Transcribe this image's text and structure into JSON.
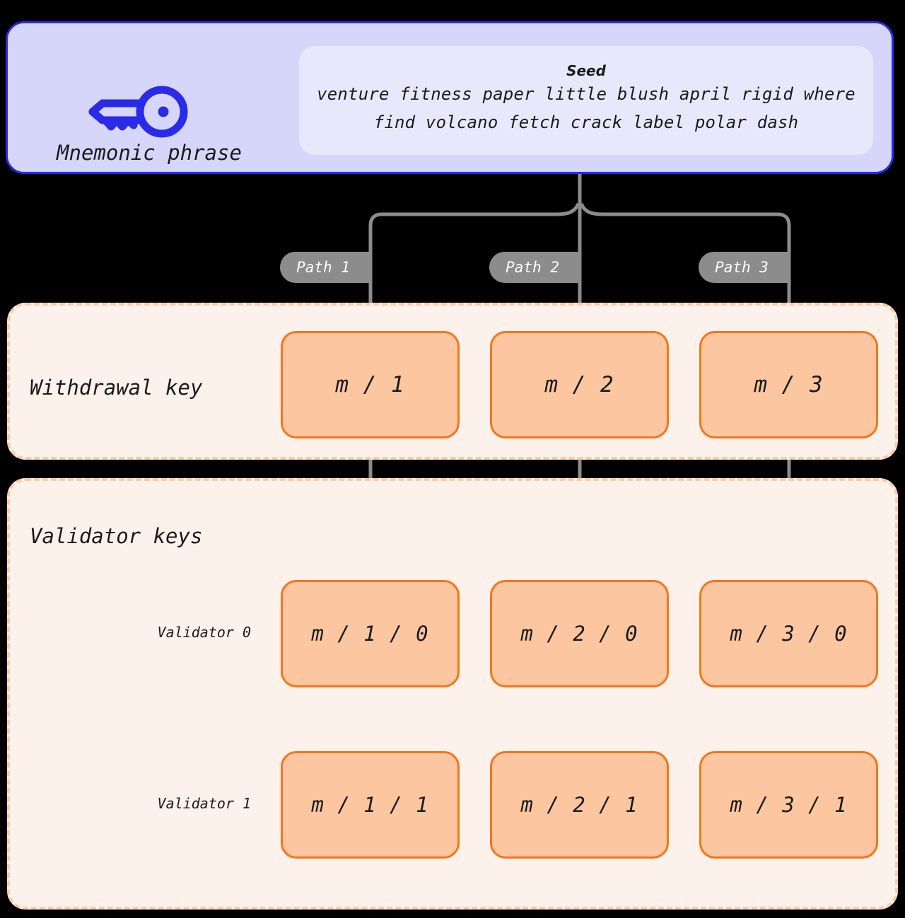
{
  "diagram": {
    "title": "Mnemonic phrase to validator key derivation",
    "colors": {
      "mnemonic_fill": "#D6D6FA",
      "mnemonic_border": "#2A2AE8",
      "seed_fill": "#E8E8FC",
      "key_icon": "#2A2AE8",
      "group_fill": "#FDF1EC",
      "group_border": "#FBCBA8",
      "key_box_fill": "#FBC6A0",
      "key_box_border": "#F4761B",
      "connector": "#8C8C8C",
      "badge_fill": "#8C8C8C",
      "badge_text": "#FFFFFF",
      "background": "#000000"
    }
  },
  "mnemonic": {
    "icon": "key-icon",
    "label": "Mnemonic phrase",
    "seed": {
      "title": "Seed",
      "line1": "venture fitness paper little blush april rigid where",
      "line2": "find volcano fetch crack label polar dash",
      "words": [
        "venture",
        "fitness",
        "paper",
        "little",
        "blush",
        "april",
        "rigid",
        "where",
        "find",
        "volcano",
        "fetch",
        "crack",
        "label",
        "polar",
        "dash"
      ]
    }
  },
  "paths": [
    {
      "label": "Path 1"
    },
    {
      "label": "Path 2"
    },
    {
      "label": "Path 3"
    }
  ],
  "withdrawal": {
    "title": "Withdrawal key",
    "keys": [
      {
        "label": "m / 1"
      },
      {
        "label": "m / 2"
      },
      {
        "label": "m / 3"
      }
    ]
  },
  "validators": {
    "title": "Validator keys",
    "rows": [
      {
        "label": "Validator 0",
        "keys": [
          {
            "label": "m / 1 / 0"
          },
          {
            "label": "m / 2 / 0"
          },
          {
            "label": "m / 3 / 0"
          }
        ]
      },
      {
        "label": "Validator 1",
        "keys": [
          {
            "label": "m / 1 / 1"
          },
          {
            "label": "m / 2 / 1"
          },
          {
            "label": "m / 3 / 1"
          }
        ]
      }
    ]
  }
}
